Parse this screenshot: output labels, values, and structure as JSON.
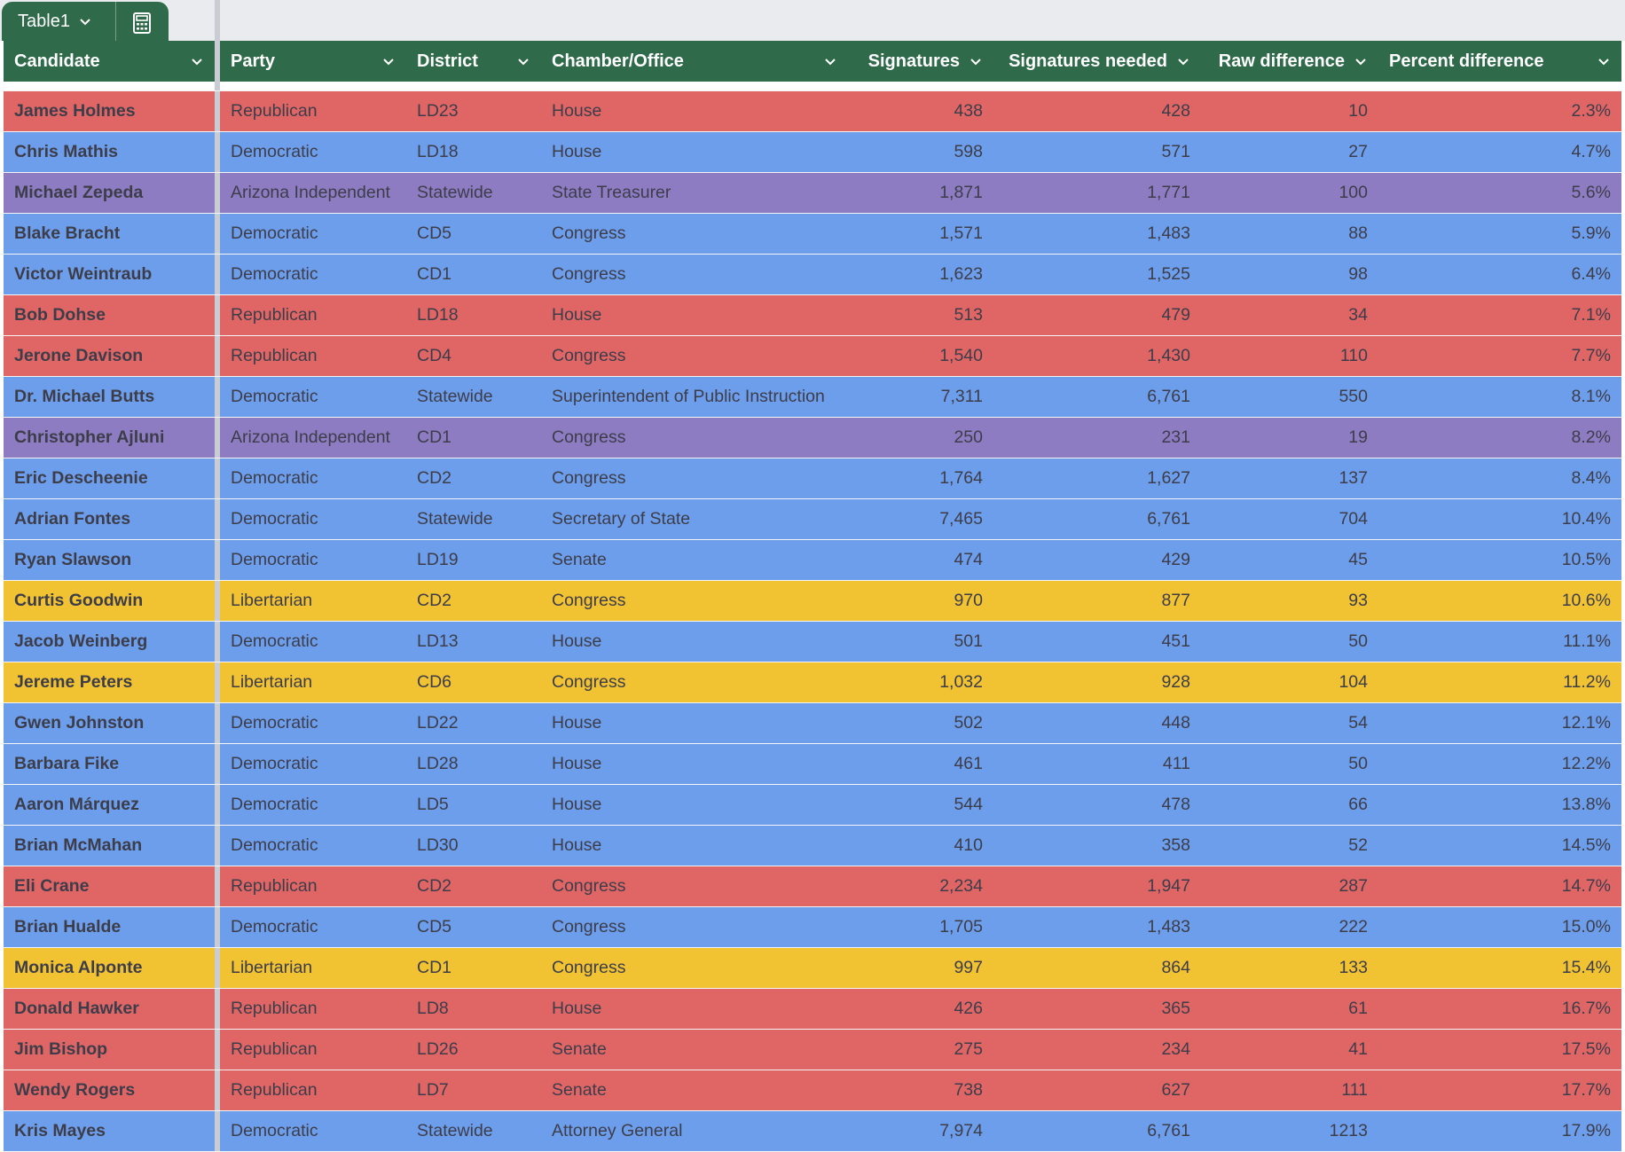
{
  "tab": {
    "name": "Table1",
    "icon": "calculator-icon"
  },
  "headers": {
    "candidate": "Candidate",
    "party": "Party",
    "district": "District",
    "chamber": "Chamber/Office",
    "signatures": "Signatures",
    "needed": "Signatures needed",
    "raw": "Raw difference",
    "pct": "Percent difference"
  },
  "colors": {
    "header": "#2f6a4a",
    "Republican": "#e06666",
    "Democratic": "#6d9eeb",
    "Arizona Independent": "#8e7cc3",
    "Libertarian": "#f1c232"
  },
  "rows": [
    {
      "candidate": "James Holmes",
      "party": "Republican",
      "district": "LD23",
      "chamber": "House",
      "signatures": "438",
      "needed": "428",
      "raw": "10",
      "pct": "2.3%"
    },
    {
      "candidate": "Chris Mathis",
      "party": "Democratic",
      "district": "LD18",
      "chamber": "House",
      "signatures": "598",
      "needed": "571",
      "raw": "27",
      "pct": "4.7%"
    },
    {
      "candidate": "Michael Zepeda",
      "party": "Arizona Independent",
      "district": "Statewide",
      "chamber": "State Treasurer",
      "signatures": "1,871",
      "needed": "1,771",
      "raw": "100",
      "pct": "5.6%"
    },
    {
      "candidate": "Blake Bracht",
      "party": "Democratic",
      "district": "CD5",
      "chamber": "Congress",
      "signatures": "1,571",
      "needed": "1,483",
      "raw": "88",
      "pct": "5.9%"
    },
    {
      "candidate": "Victor Weintraub",
      "party": "Democratic",
      "district": "CD1",
      "chamber": "Congress",
      "signatures": "1,623",
      "needed": "1,525",
      "raw": "98",
      "pct": "6.4%"
    },
    {
      "candidate": "Bob Dohse",
      "party": "Republican",
      "district": "LD18",
      "chamber": "House",
      "signatures": "513",
      "needed": "479",
      "raw": "34",
      "pct": "7.1%"
    },
    {
      "candidate": "Jerone Davison",
      "party": "Republican",
      "district": "CD4",
      "chamber": "Congress",
      "signatures": "1,540",
      "needed": "1,430",
      "raw": "110",
      "pct": "7.7%"
    },
    {
      "candidate": "Dr. Michael Butts",
      "party": "Democratic",
      "district": "Statewide",
      "chamber": "Superintendent of Public Instruction",
      "signatures": "7,311",
      "needed": "6,761",
      "raw": "550",
      "pct": "8.1%"
    },
    {
      "candidate": "Christopher Ajluni",
      "party": "Arizona Independent",
      "district": "CD1",
      "chamber": "Congress",
      "signatures": "250",
      "needed": "231",
      "raw": "19",
      "pct": "8.2%"
    },
    {
      "candidate": "Eric Descheenie",
      "party": "Democratic",
      "district": "CD2",
      "chamber": "Congress",
      "signatures": "1,764",
      "needed": "1,627",
      "raw": "137",
      "pct": "8.4%"
    },
    {
      "candidate": "Adrian Fontes",
      "party": "Democratic",
      "district": "Statewide",
      "chamber": "Secretary of State",
      "signatures": "7,465",
      "needed": "6,761",
      "raw": "704",
      "pct": "10.4%"
    },
    {
      "candidate": "Ryan Slawson",
      "party": "Democratic",
      "district": "LD19",
      "chamber": "Senate",
      "signatures": "474",
      "needed": "429",
      "raw": "45",
      "pct": "10.5%"
    },
    {
      "candidate": "Curtis Goodwin",
      "party": "Libertarian",
      "district": "CD2",
      "chamber": "Congress",
      "signatures": "970",
      "needed": "877",
      "raw": "93",
      "pct": "10.6%"
    },
    {
      "candidate": "Jacob Weinberg",
      "party": "Democratic",
      "district": "LD13",
      "chamber": "House",
      "signatures": "501",
      "needed": "451",
      "raw": "50",
      "pct": "11.1%"
    },
    {
      "candidate": "Jereme Peters",
      "party": "Libertarian",
      "district": "CD6",
      "chamber": "Congress",
      "signatures": "1,032",
      "needed": "928",
      "raw": "104",
      "pct": "11.2%"
    },
    {
      "candidate": "Gwen Johnston",
      "party": "Democratic",
      "district": "LD22",
      "chamber": "House",
      "signatures": "502",
      "needed": "448",
      "raw": "54",
      "pct": "12.1%"
    },
    {
      "candidate": "Barbara Fike",
      "party": "Democratic",
      "district": "LD28",
      "chamber": "House",
      "signatures": "461",
      "needed": "411",
      "raw": "50",
      "pct": "12.2%"
    },
    {
      "candidate": "Aaron Márquez",
      "party": "Democratic",
      "district": "LD5",
      "chamber": "House",
      "signatures": "544",
      "needed": "478",
      "raw": "66",
      "pct": "13.8%"
    },
    {
      "candidate": "Brian McMahan",
      "party": "Democratic",
      "district": "LD30",
      "chamber": "House",
      "signatures": "410",
      "needed": "358",
      "raw": "52",
      "pct": "14.5%"
    },
    {
      "candidate": "Eli Crane",
      "party": "Republican",
      "district": "CD2",
      "chamber": "Congress",
      "signatures": "2,234",
      "needed": "1,947",
      "raw": "287",
      "pct": "14.7%"
    },
    {
      "candidate": "Brian Hualde",
      "party": "Democratic",
      "district": "CD5",
      "chamber": "Congress",
      "signatures": "1,705",
      "needed": "1,483",
      "raw": "222",
      "pct": "15.0%"
    },
    {
      "candidate": "Monica Alponte",
      "party": "Libertarian",
      "district": "CD1",
      "chamber": "Congress",
      "signatures": "997",
      "needed": "864",
      "raw": "133",
      "pct": "15.4%"
    },
    {
      "candidate": "Donald Hawker",
      "party": "Republican",
      "district": "LD8",
      "chamber": "House",
      "signatures": "426",
      "needed": "365",
      "raw": "61",
      "pct": "16.7%"
    },
    {
      "candidate": "Jim Bishop",
      "party": "Republican",
      "district": "LD26",
      "chamber": "Senate",
      "signatures": "275",
      "needed": "234",
      "raw": "41",
      "pct": "17.5%"
    },
    {
      "candidate": "Wendy Rogers",
      "party": "Republican",
      "district": "LD7",
      "chamber": "Senate",
      "signatures": "738",
      "needed": "627",
      "raw": "111",
      "pct": "17.7%"
    },
    {
      "candidate": "Kris Mayes",
      "party": "Democratic",
      "district": "Statewide",
      "chamber": "Attorney General",
      "signatures": "7,974",
      "needed": "6,761",
      "raw": "1213",
      "pct": "17.9%"
    }
  ]
}
